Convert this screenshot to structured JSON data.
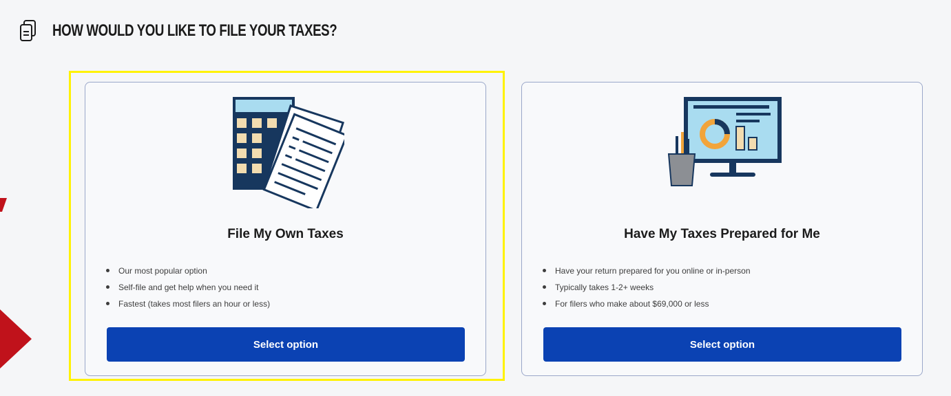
{
  "page": {
    "title": "How would you like to file your taxes?"
  },
  "options": [
    {
      "title": "File My Own Taxes",
      "bullets": [
        "Our most popular option",
        "Self-file and get help when you need it",
        "Fastest (takes most filers an hour or less)"
      ],
      "button_label": "Select option",
      "icon": "calculator-forms-icon",
      "highlighted": true
    },
    {
      "title": "Have My Taxes Prepared for Me",
      "bullets": [
        "Have your return prepared for you online or in-person",
        "Typically takes 1-2+ weeks",
        "For filers who make about $69,000 or less"
      ],
      "button_label": "Select option",
      "icon": "monitor-chart-icon",
      "highlighted": false
    }
  ],
  "colors": {
    "primary_button": "#0b42b3",
    "highlight_border": "#fff200",
    "annotation_arrow": "#c0121b",
    "illustration_navy": "#17375e",
    "illustration_blue": "#a9dcf0",
    "illustration_tan": "#f2dcb0"
  }
}
